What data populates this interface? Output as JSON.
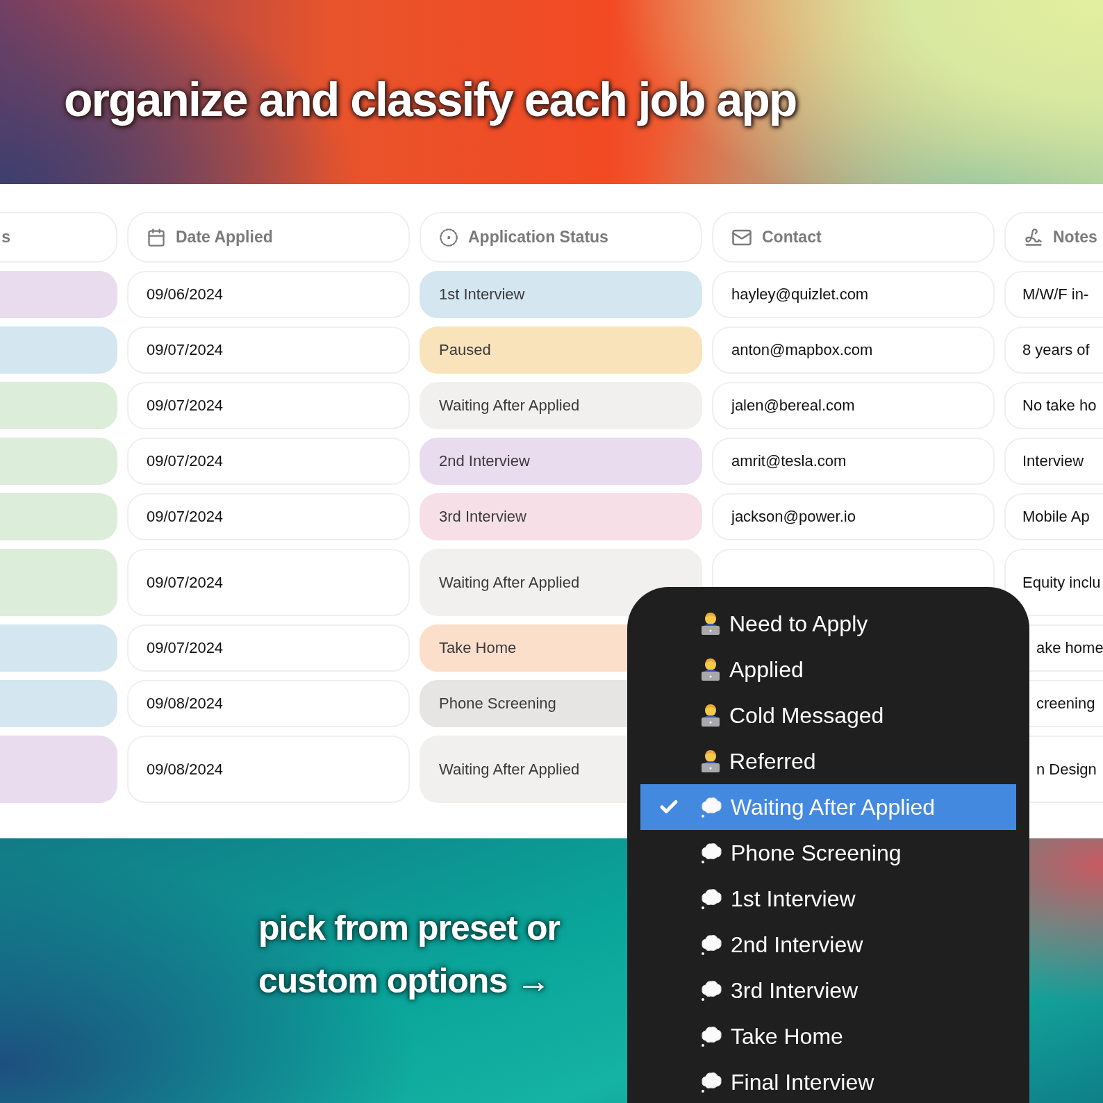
{
  "headline": "organize and classify each job app",
  "table": {
    "columns": [
      {
        "label": "s"
      },
      {
        "label": "Date Applied"
      },
      {
        "label": "Application Status"
      },
      {
        "label": "Contact"
      },
      {
        "label": "Notes"
      }
    ],
    "rows": [
      {
        "tag": {
          "color": "#e8dcee"
        },
        "date": "09/06/2024",
        "status": {
          "text": "1st Interview",
          "color": "#d4e6f0"
        },
        "contact": "hayley@quizlet.com",
        "notes": "M/W/F in-"
      },
      {
        "tag": {
          "color": "#d4e6f0"
        },
        "date": "09/07/2024",
        "status": {
          "text": "Paused",
          "color": "#f9e3bb"
        },
        "contact": "anton@mapbox.com",
        "notes": "8 years of"
      },
      {
        "tag": {
          "color": "#dcedda"
        },
        "date": "09/07/2024",
        "status": {
          "text": "Waiting After Applied",
          "color": "#f1f0ef"
        },
        "contact": "jalen@bereal.com",
        "notes": "No take ho"
      },
      {
        "tag": {
          "color": "#dcedda"
        },
        "date": "09/07/2024",
        "status": {
          "text": "2nd Interview",
          "color": "#e8dcee"
        },
        "contact": "amrit@tesla.com",
        "notes": "Interview"
      },
      {
        "tag": {
          "color": "#dcedda"
        },
        "date": "09/07/2024",
        "status": {
          "text": "3rd Interview",
          "color": "#f6dfe7"
        },
        "contact": "jackson@power.io",
        "notes": "Mobile Ap"
      },
      {
        "tag": {
          "color": "#dcedda"
        },
        "date": "09/07/2024",
        "status": {
          "text": "Waiting After Applied",
          "color": "#f1f0ef"
        },
        "notes": "Equity inclu"
      },
      {
        "tag": {
          "color": "#d4e6f0"
        },
        "date": "09/07/2024",
        "status": {
          "text": "Take Home",
          "color": "#fbdfcb"
        },
        "notes": "ake home"
      },
      {
        "tag": {
          "color": "#d4e6f0"
        },
        "date": "09/08/2024",
        "status": {
          "text": "Phone Screening",
          "color": "#e6e5e3"
        },
        "notes": "creening"
      },
      {
        "tag": {
          "color": "#e8dcee"
        },
        "date": "09/08/2024",
        "status": {
          "text": "Waiting After Applied",
          "color": "#f1f0ef"
        },
        "notes": "n Design"
      }
    ]
  },
  "dropdown": {
    "items": [
      {
        "label": "Need to Apply",
        "kind": "person",
        "selected": false
      },
      {
        "label": "Applied",
        "kind": "person",
        "selected": false
      },
      {
        "label": "Cold Messaged",
        "kind": "person",
        "selected": false
      },
      {
        "label": "Referred",
        "kind": "person",
        "selected": false
      },
      {
        "label": "Waiting After Applied",
        "kind": "bubble",
        "selected": true
      },
      {
        "label": "Phone Screening",
        "kind": "bubble",
        "selected": false
      },
      {
        "label": "1st Interview",
        "kind": "bubble",
        "selected": false
      },
      {
        "label": "2nd Interview",
        "kind": "bubble",
        "selected": false
      },
      {
        "label": "3rd Interview",
        "kind": "bubble",
        "selected": false
      },
      {
        "label": "Take Home",
        "kind": "bubble",
        "selected": false
      },
      {
        "label": "Final Interview",
        "kind": "bubble",
        "selected": false
      }
    ]
  },
  "caption": [
    "pick from preset or",
    "custom options →"
  ]
}
